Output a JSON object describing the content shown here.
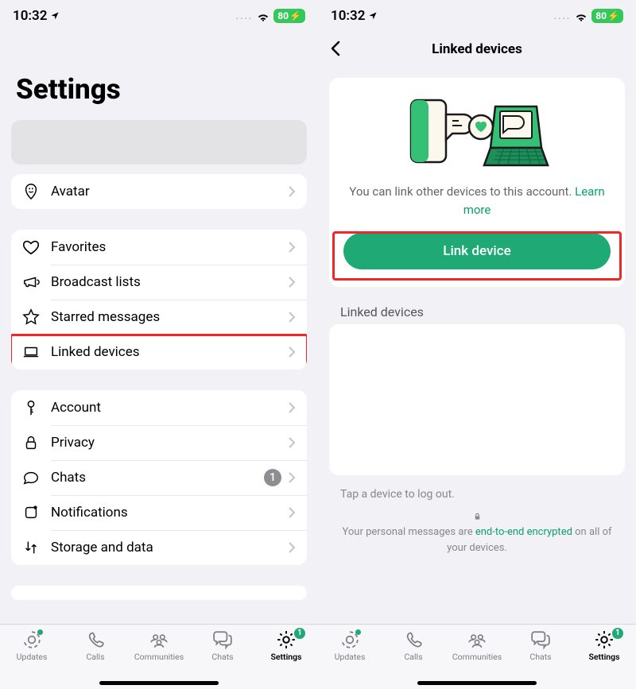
{
  "status": {
    "time": "10:32",
    "battery": "80",
    "bolt": "⚡"
  },
  "page1": {
    "title": "Settings",
    "rows": {
      "avatar": "Avatar",
      "favorites": "Favorites",
      "broadcast": "Broadcast lists",
      "starred": "Starred messages",
      "linked": "Linked devices",
      "account": "Account",
      "privacy": "Privacy",
      "chats": "Chats",
      "notifications": "Notifications",
      "storage": "Storage and data"
    },
    "chats_badge": "1"
  },
  "page2": {
    "title": "Linked devices",
    "info1": "You can link other devices to this account. ",
    "learn": "Learn more",
    "button": "Link device",
    "section": "Linked devices",
    "tap": "Tap a device to log out.",
    "enc1": "Your personal messages are ",
    "enc_link": "end-to-end encrypted",
    "enc2": " on all of your devices."
  },
  "tabs": {
    "updates": "Updates",
    "calls": "Calls",
    "communities": "Communities",
    "chats": "Chats",
    "settings": "Settings",
    "settings_badge": "1"
  }
}
